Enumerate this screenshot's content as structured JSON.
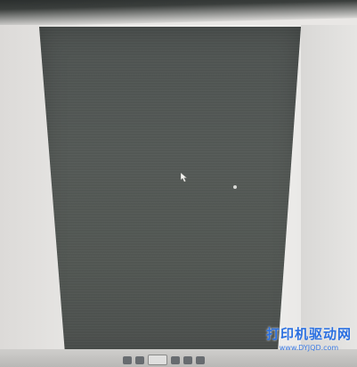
{
  "watermark": {
    "title": "打印机驱动网",
    "url": "www.DYJQD.com"
  },
  "icons": {
    "cursor": "mouse-pointer-icon"
  },
  "colors": {
    "page_preview": "#535854",
    "canvas": "#ecebe9",
    "watermark": "#2a6fe0"
  }
}
